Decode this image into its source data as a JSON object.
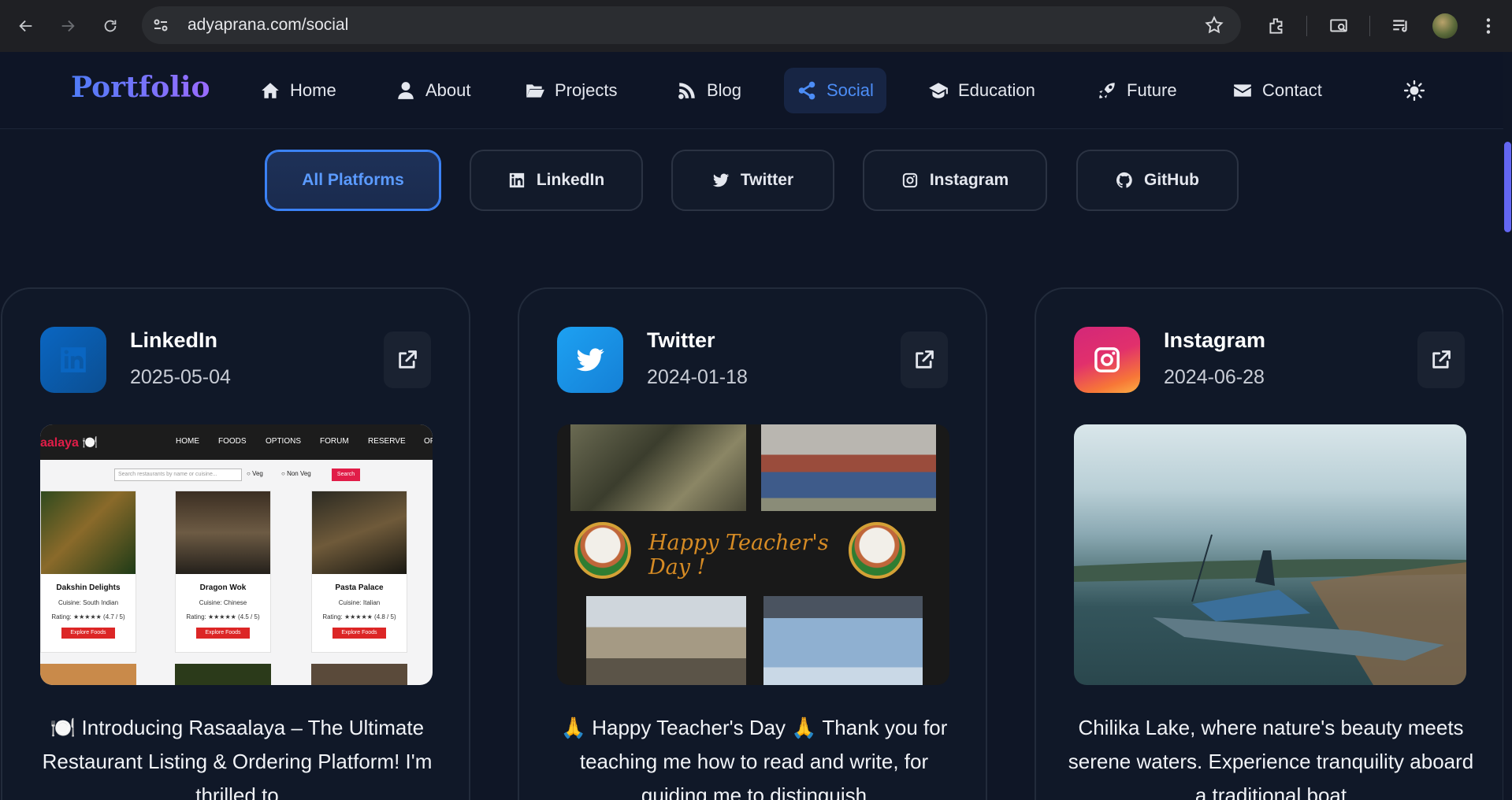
{
  "browser": {
    "url": "adyaprana.com/social"
  },
  "site": {
    "brand": "Portfolio",
    "nav": [
      {
        "label": "Home",
        "icon": "home-icon"
      },
      {
        "label": "About",
        "icon": "user-icon"
      },
      {
        "label": "Projects",
        "icon": "folder-open-icon"
      },
      {
        "label": "Blog",
        "icon": "blog-icon"
      },
      {
        "label": "Social",
        "icon": "share-icon",
        "active": true
      },
      {
        "label": "Education",
        "icon": "graduation-cap-icon"
      },
      {
        "label": "Future",
        "icon": "rocket-icon"
      },
      {
        "label": "Contact",
        "icon": "envelope-icon"
      }
    ]
  },
  "filters": [
    {
      "label": "All Platforms",
      "active": true
    },
    {
      "label": "LinkedIn",
      "icon": "linkedin-icon"
    },
    {
      "label": "Twitter",
      "icon": "twitter-icon"
    },
    {
      "label": "Instagram",
      "icon": "instagram-icon"
    },
    {
      "label": "GitHub",
      "icon": "github-icon"
    }
  ],
  "posts": [
    {
      "platform": "LinkedIn",
      "date": "2025-05-04",
      "text": "🍽️ Introducing Rasaalaya – The Ultimate Restaurant Listing & Ordering Platform! I'm thrilled to",
      "color": "#0a66c2",
      "thumb": {
        "logo": "aalaya 🍽️",
        "menu": [
          "HOME",
          "FOODS",
          "OPTIONS",
          "FORUM",
          "RESERVE",
          "OF"
        ],
        "search_placeholder": "Search restaurants by name or cuisine...",
        "veg": "Veg",
        "non_veg": "Non Veg",
        "search_button": "Search",
        "restaurants": [
          {
            "name": "Dakshin Delights",
            "cuisine": "Cuisine: South Indian",
            "rating": "Rating: ★★★★★ (4.7 / 5)",
            "button": "Explore Foods"
          },
          {
            "name": "Dragon Wok",
            "cuisine": "Cuisine: Chinese",
            "rating": "Rating: ★★★★★ (4.5 / 5)",
            "button": "Explore Foods"
          },
          {
            "name": "Pasta Palace",
            "cuisine": "Cuisine: Italian",
            "rating": "Rating: ★★★★★ (4.8 / 5)",
            "button": "Explore Foods"
          }
        ]
      }
    },
    {
      "platform": "Twitter",
      "date": "2024-01-18",
      "text": "🙏 Happy Teacher's Day 🙏 Thank you for teaching me how to read and write, for guiding me to distinguish",
      "color": "#1d9bf0",
      "thumb": {
        "caption": "Happy Teacher's Day !"
      }
    },
    {
      "platform": "Instagram",
      "date": "2024-06-28",
      "text": "Chilika Lake, where nature's beauty meets serene waters. Experience tranquility aboard a traditional boat",
      "color": "#e1306c"
    }
  ]
}
